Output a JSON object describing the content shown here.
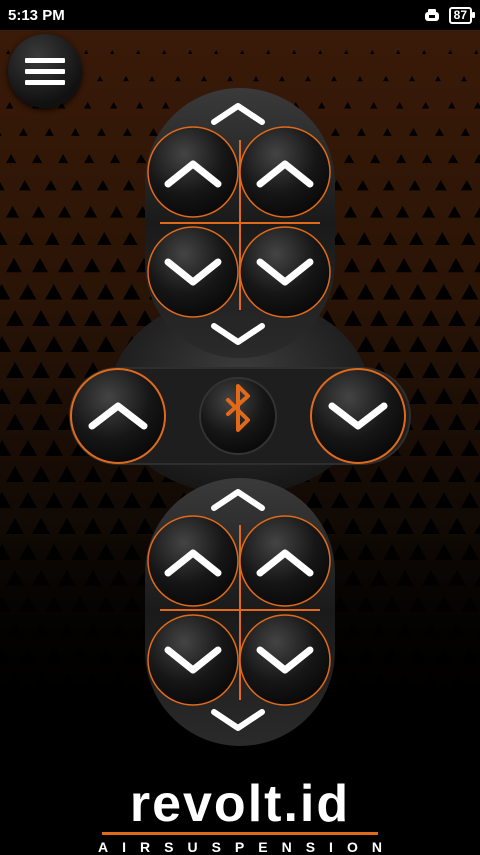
{
  "status_bar": {
    "time": "5:13 PM",
    "battery": "87"
  },
  "menu": {
    "icon": "hamburger-menu-icon"
  },
  "controller": {
    "center_icon": "bluetooth-icon",
    "accent_color": "#e06a1a",
    "upper_group": {
      "all_up_icon": "chevron-up-icon",
      "all_down_icon": "chevron-down-icon",
      "left_up_icon": "chevron-up-icon",
      "right_up_icon": "chevron-up-icon",
      "left_down_icon": "chevron-down-icon",
      "right_down_icon": "chevron-down-icon"
    },
    "middle_row": {
      "left_icon": "chevron-up-icon",
      "right_icon": "chevron-down-icon"
    },
    "lower_group": {
      "all_up_icon": "chevron-up-icon",
      "all_down_icon": "chevron-down-icon",
      "left_up_icon": "chevron-up-icon",
      "right_up_icon": "chevron-up-icon",
      "left_down_icon": "chevron-down-icon",
      "right_down_icon": "chevron-down-icon"
    }
  },
  "brand": {
    "name": "revolt.id",
    "tagline": "AIRSUSPENSION"
  }
}
